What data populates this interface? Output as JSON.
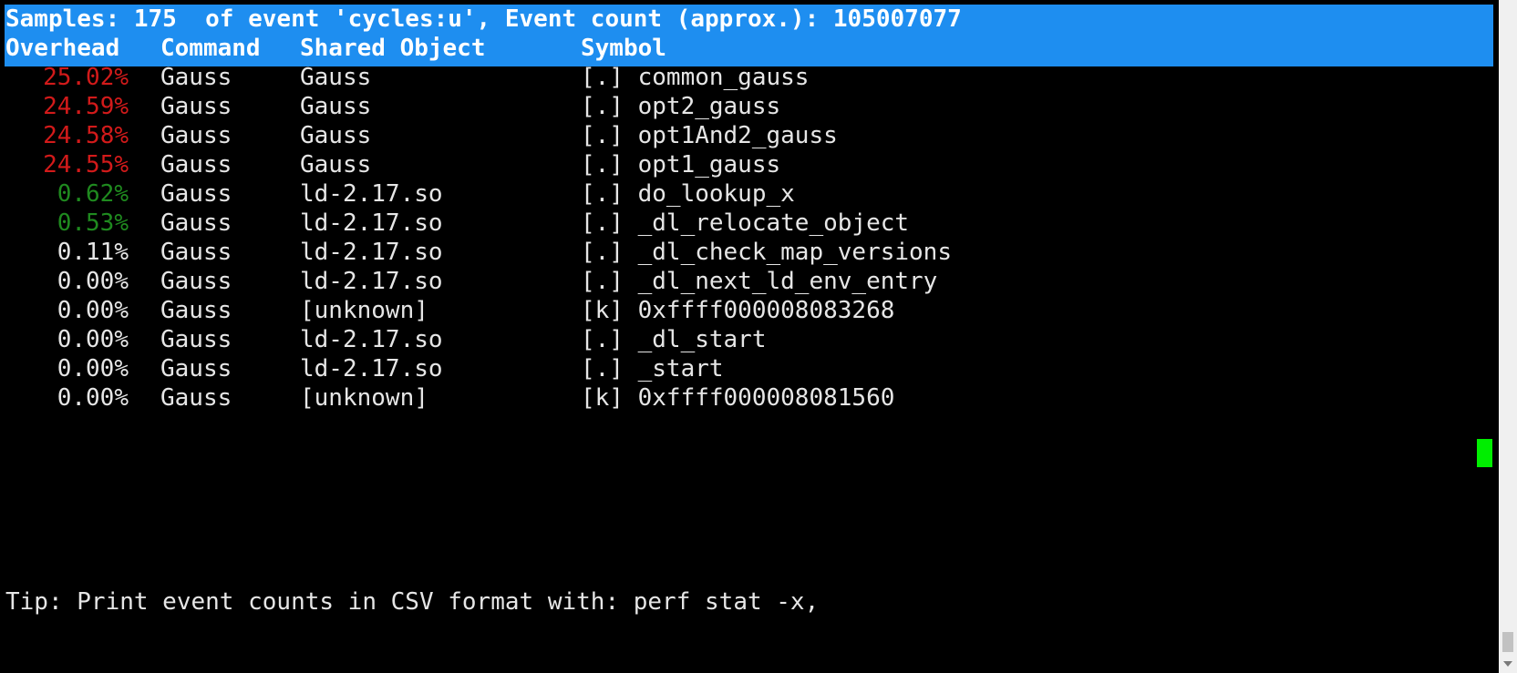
{
  "header": {
    "summary": "Samples: 175  of event 'cycles:u', Event count (approx.): 105007077",
    "columns": {
      "overhead": "Overhead",
      "command": "Command",
      "shared_object": "Shared Object",
      "symbol": "Symbol"
    }
  },
  "rows": [
    {
      "overhead": "25.02%",
      "command": "Gauss",
      "shared_object": "Gauss",
      "symbol": "[.] common_gauss",
      "level": "high"
    },
    {
      "overhead": "24.59%",
      "command": "Gauss",
      "shared_object": "Gauss",
      "symbol": "[.] opt2_gauss",
      "level": "high"
    },
    {
      "overhead": "24.58%",
      "command": "Gauss",
      "shared_object": "Gauss",
      "symbol": "[.] opt1And2_gauss",
      "level": "high"
    },
    {
      "overhead": "24.55%",
      "command": "Gauss",
      "shared_object": "Gauss",
      "symbol": "[.] opt1_gauss",
      "level": "high"
    },
    {
      "overhead": "0.62%",
      "command": "Gauss",
      "shared_object": "ld-2.17.so",
      "symbol": "[.] do_lookup_x",
      "level": "medium"
    },
    {
      "overhead": "0.53%",
      "command": "Gauss",
      "shared_object": "ld-2.17.so",
      "symbol": "[.] _dl_relocate_object",
      "level": "medium"
    },
    {
      "overhead": "0.11%",
      "command": "Gauss",
      "shared_object": "ld-2.17.so",
      "symbol": "[.] _dl_check_map_versions",
      "level": "low"
    },
    {
      "overhead": "0.00%",
      "command": "Gauss",
      "shared_object": "ld-2.17.so",
      "symbol": "[.] _dl_next_ld_env_entry",
      "level": "low"
    },
    {
      "overhead": "0.00%",
      "command": "Gauss",
      "shared_object": "[unknown]",
      "symbol": "[k] 0xffff000008083268",
      "level": "low"
    },
    {
      "overhead": "0.00%",
      "command": "Gauss",
      "shared_object": "ld-2.17.so",
      "symbol": "[.] _dl_start",
      "level": "low"
    },
    {
      "overhead": "0.00%",
      "command": "Gauss",
      "shared_object": "ld-2.17.so",
      "symbol": "[.] _start",
      "level": "low"
    },
    {
      "overhead": "0.00%",
      "command": "Gauss",
      "shared_object": "[unknown]",
      "symbol": "[k] 0xffff000008081560",
      "level": "low"
    }
  ],
  "footer": {
    "tip": "Tip: Print event counts in CSV format with: perf stat -x,"
  },
  "colors": {
    "header_background": "#1e8ef0",
    "high_overhead": "#d21a1a",
    "medium_overhead": "#1f8a1f",
    "cursor": "#00ee00"
  }
}
